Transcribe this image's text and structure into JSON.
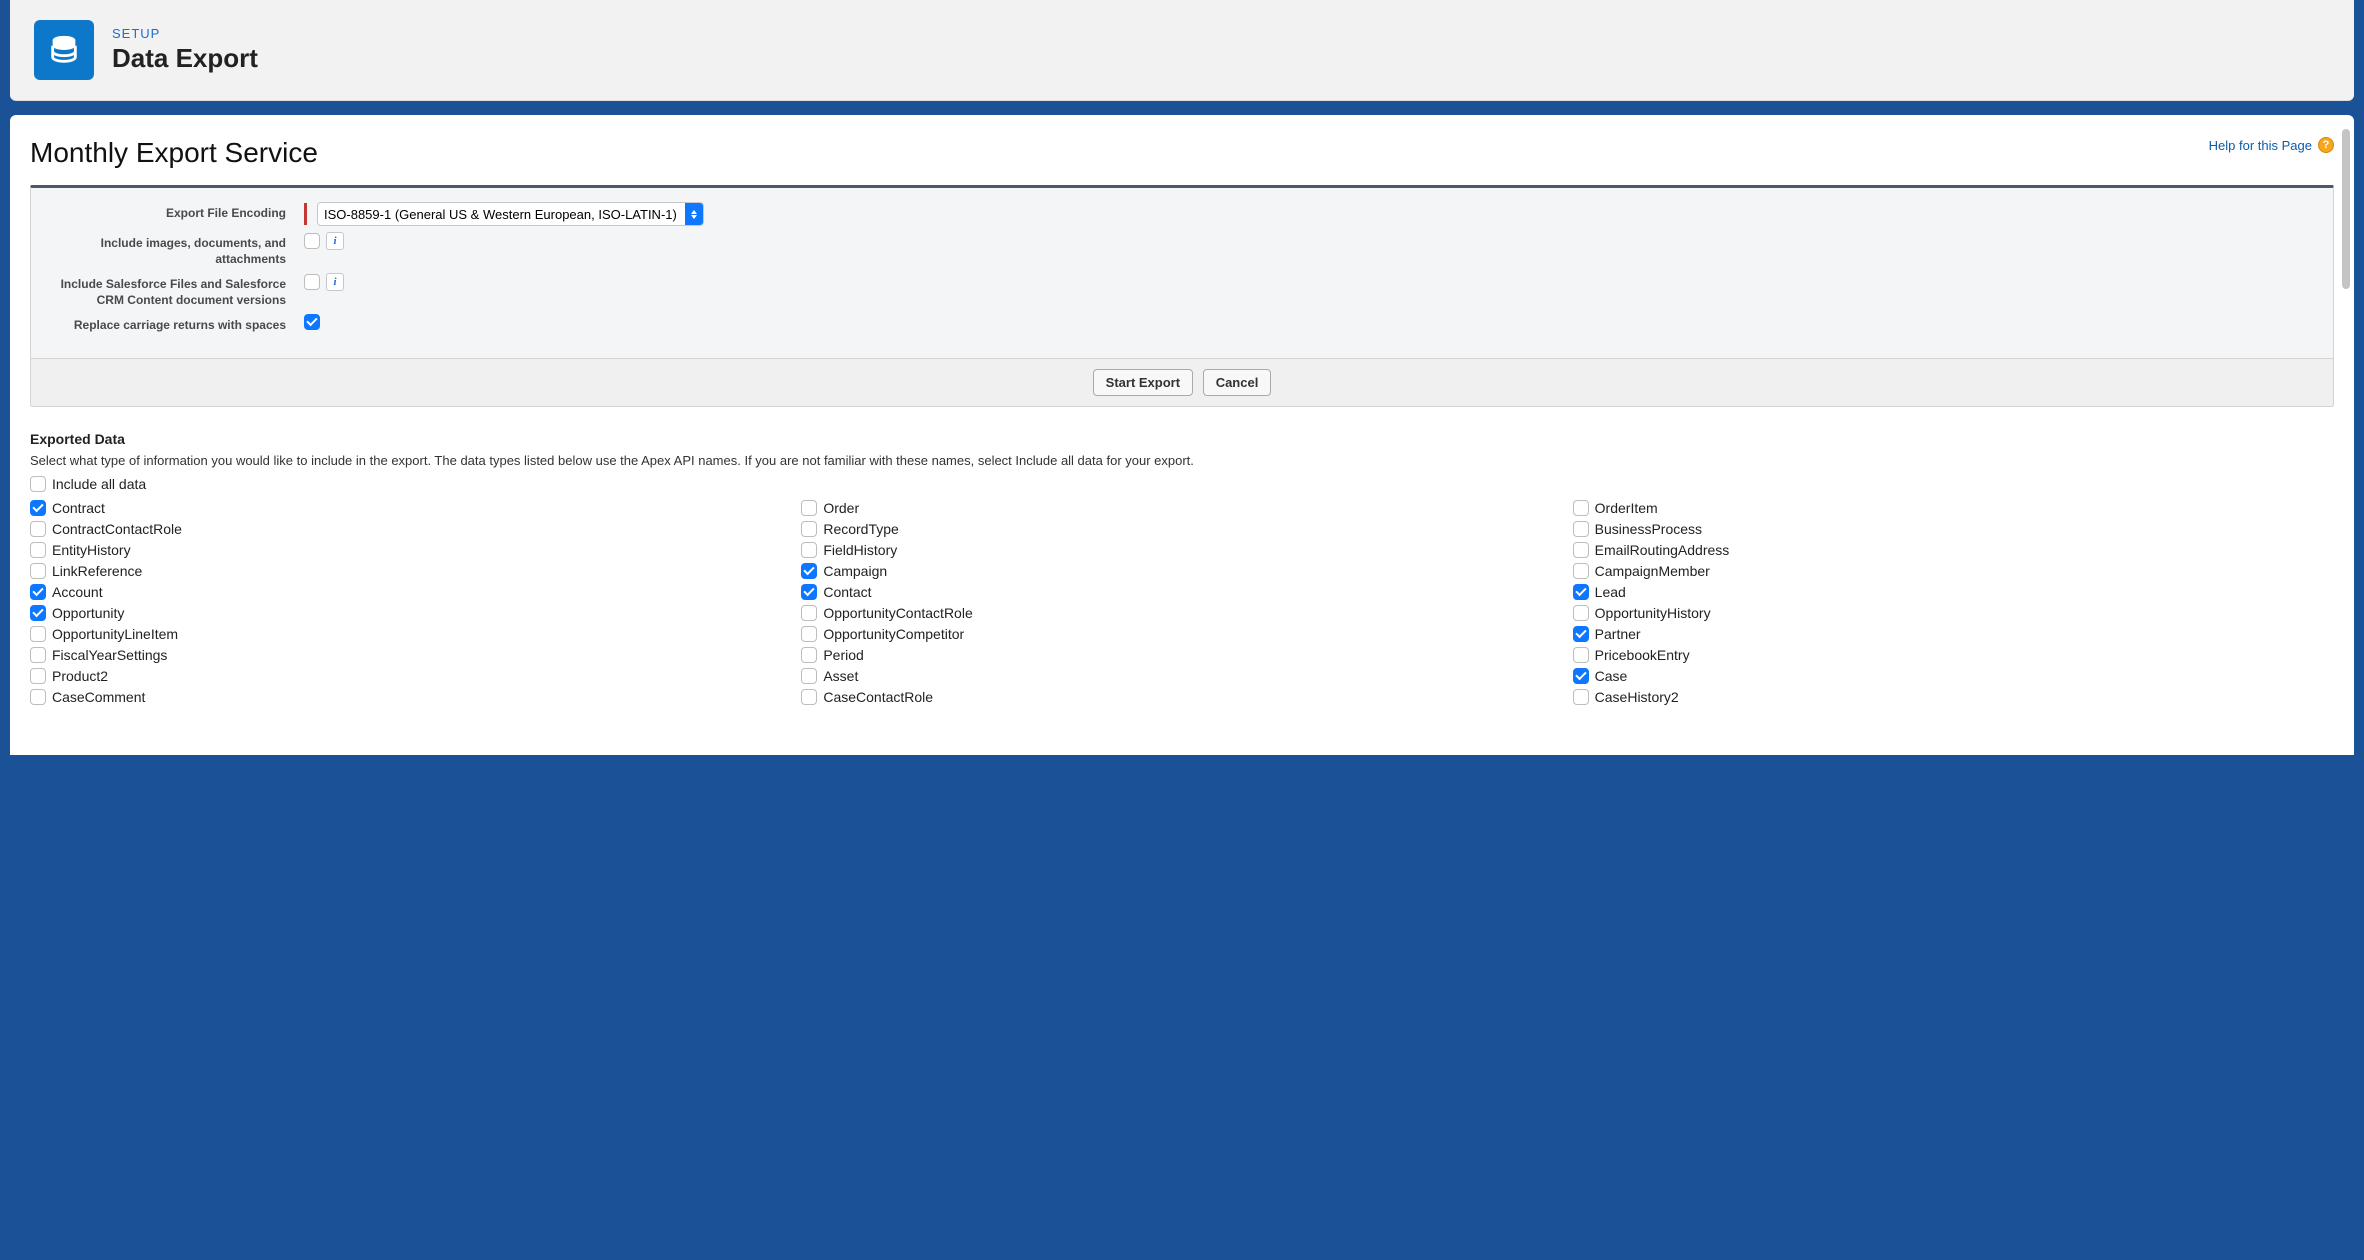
{
  "header": {
    "setup_label": "SETUP",
    "page_title": "Data Export"
  },
  "panel": {
    "heading": "Monthly Export Service",
    "help_text": "Help for this Page"
  },
  "settings": {
    "encoding_label": "Export File Encoding",
    "encoding_value": "ISO-8859-1 (General US & Western European, ISO-LATIN-1)",
    "include_images_label": "Include images, documents, and attachments",
    "include_images_checked": false,
    "include_files_label": "Include Salesforce Files and Salesforce CRM Content document versions",
    "include_files_checked": false,
    "replace_cr_label": "Replace carriage returns with spaces",
    "replace_cr_checked": true
  },
  "buttons": {
    "start": "Start Export",
    "cancel": "Cancel"
  },
  "exported": {
    "title": "Exported Data",
    "description": "Select what type of information you would like to include in the export. The data types listed below use the Apex API names. If you are not familiar with these names, select Include all data for your export.",
    "include_all_label": "Include all data",
    "include_all_checked": false,
    "items": [
      {
        "label": "Contract",
        "checked": true
      },
      {
        "label": "Order",
        "checked": false
      },
      {
        "label": "OrderItem",
        "checked": false
      },
      {
        "label": "ContractContactRole",
        "checked": false
      },
      {
        "label": "RecordType",
        "checked": false
      },
      {
        "label": "BusinessProcess",
        "checked": false
      },
      {
        "label": "EntityHistory",
        "checked": false
      },
      {
        "label": "FieldHistory",
        "checked": false
      },
      {
        "label": "EmailRoutingAddress",
        "checked": false
      },
      {
        "label": "LinkReference",
        "checked": false
      },
      {
        "label": "Campaign",
        "checked": true
      },
      {
        "label": "CampaignMember",
        "checked": false
      },
      {
        "label": "Account",
        "checked": true
      },
      {
        "label": "Contact",
        "checked": true
      },
      {
        "label": "Lead",
        "checked": true
      },
      {
        "label": "Opportunity",
        "checked": true
      },
      {
        "label": "OpportunityContactRole",
        "checked": false
      },
      {
        "label": "OpportunityHistory",
        "checked": false
      },
      {
        "label": "OpportunityLineItem",
        "checked": false
      },
      {
        "label": "OpportunityCompetitor",
        "checked": false
      },
      {
        "label": "Partner",
        "checked": true
      },
      {
        "label": "FiscalYearSettings",
        "checked": false
      },
      {
        "label": "Period",
        "checked": false
      },
      {
        "label": "PricebookEntry",
        "checked": false
      },
      {
        "label": "Product2",
        "checked": false
      },
      {
        "label": "Asset",
        "checked": false
      },
      {
        "label": "Case",
        "checked": true
      },
      {
        "label": "CaseComment",
        "checked": false
      },
      {
        "label": "CaseContactRole",
        "checked": false
      },
      {
        "label": "CaseHistory2",
        "checked": false
      }
    ]
  }
}
